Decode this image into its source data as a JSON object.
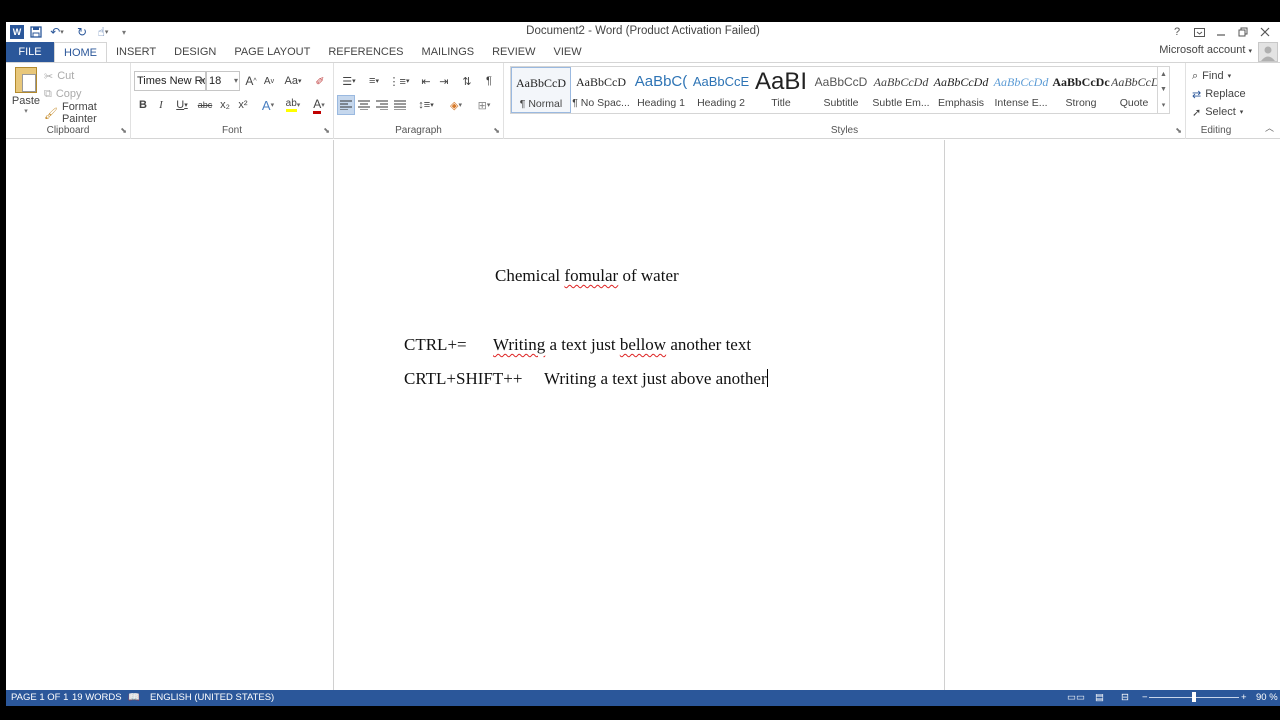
{
  "window": {
    "title": "Document2 - Word (Product Activation Failed)",
    "help": "?",
    "qat_more": "▾"
  },
  "tabs": {
    "file": "FILE",
    "items": [
      "HOME",
      "INSERT",
      "DESIGN",
      "PAGE LAYOUT",
      "REFERENCES",
      "MAILINGS",
      "REVIEW",
      "VIEW"
    ],
    "active": "HOME"
  },
  "account": {
    "label": "Microsoft account",
    "caret": "▾"
  },
  "clipboard": {
    "paste": "Paste",
    "cut": "Cut",
    "copy": "Copy",
    "format_painter": "Format Painter",
    "label": "Clipboard"
  },
  "font": {
    "family": "Times New Ro",
    "size": "18",
    "grow": "A",
    "shrink": "A",
    "case": "Aa",
    "bold": "B",
    "italic": "I",
    "underline": "U",
    "strike": "abc",
    "subscript": "x₂",
    "superscript": "x²",
    "effects": "A",
    "highlight": "ab",
    "color": "A",
    "label": "Font"
  },
  "paragraph": {
    "show_marks": "¶",
    "label": "Paragraph"
  },
  "styles": {
    "label": "Styles",
    "items": [
      {
        "sample": "AaBbCcD",
        "name": "¶ Normal"
      },
      {
        "sample": "AaBbCcD",
        "name": "¶ No Spac..."
      },
      {
        "sample": "AaBbC(",
        "name": "Heading 1"
      },
      {
        "sample": "AaBbCcE",
        "name": "Heading 2"
      },
      {
        "sample": "AaBI",
        "name": "Title"
      },
      {
        "sample": "AaBbCcD",
        "name": "Subtitle"
      },
      {
        "sample": "AaBbCcDd",
        "name": "Subtle Em..."
      },
      {
        "sample": "AaBbCcDd",
        "name": "Emphasis"
      },
      {
        "sample": "AaBbCcDd",
        "name": "Intense E..."
      },
      {
        "sample": "AaBbCcDc",
        "name": "Strong"
      },
      {
        "sample": "AaBbCcD(",
        "name": "Quote"
      }
    ],
    "selected_index": 0
  },
  "editing": {
    "find": "Find",
    "replace": "Replace",
    "select": "Select",
    "label": "Editing"
  },
  "document": {
    "heading": {
      "before": "Chemical ",
      "squiggle": "fomular",
      "after": " of water"
    },
    "line1": {
      "shortcut": "CTRL+=",
      "squiggle": "Writing",
      "mid": " a text just ",
      "squiggle2": "bellow",
      "after": " another text"
    },
    "line2": {
      "shortcut": "CRTL+SHIFT++",
      "text": "Writing a text just above another"
    }
  },
  "status": {
    "page": "PAGE 1 OF 1",
    "words": "19 WORDS",
    "language": "ENGLISH (UNITED STATES)",
    "zoom_minus": "−",
    "zoom_plus": "+",
    "zoom": "90 %",
    "zoom_fraction": 0.5
  },
  "colors": {
    "accent": "#2b579a",
    "highlight": "#ffff00",
    "font_color": "#c00000",
    "squiggle": "#dd2222"
  }
}
